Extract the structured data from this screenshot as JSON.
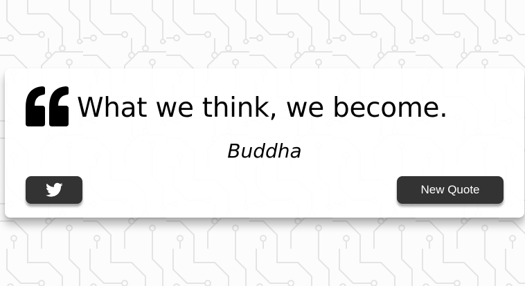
{
  "quote": {
    "text": "What we think, we become.",
    "author": "Buddha",
    "quote_icon": "quote-left-icon"
  },
  "actions": {
    "twitter_icon": "twitter-icon",
    "new_quote_label": "New Quote"
  },
  "colors": {
    "button_bg": "#333333",
    "button_text": "#ffffff",
    "text": "#000000",
    "card_bg": "#ffffff",
    "background": "#fcfcfc",
    "pattern_stroke": "#e6e6e6"
  }
}
